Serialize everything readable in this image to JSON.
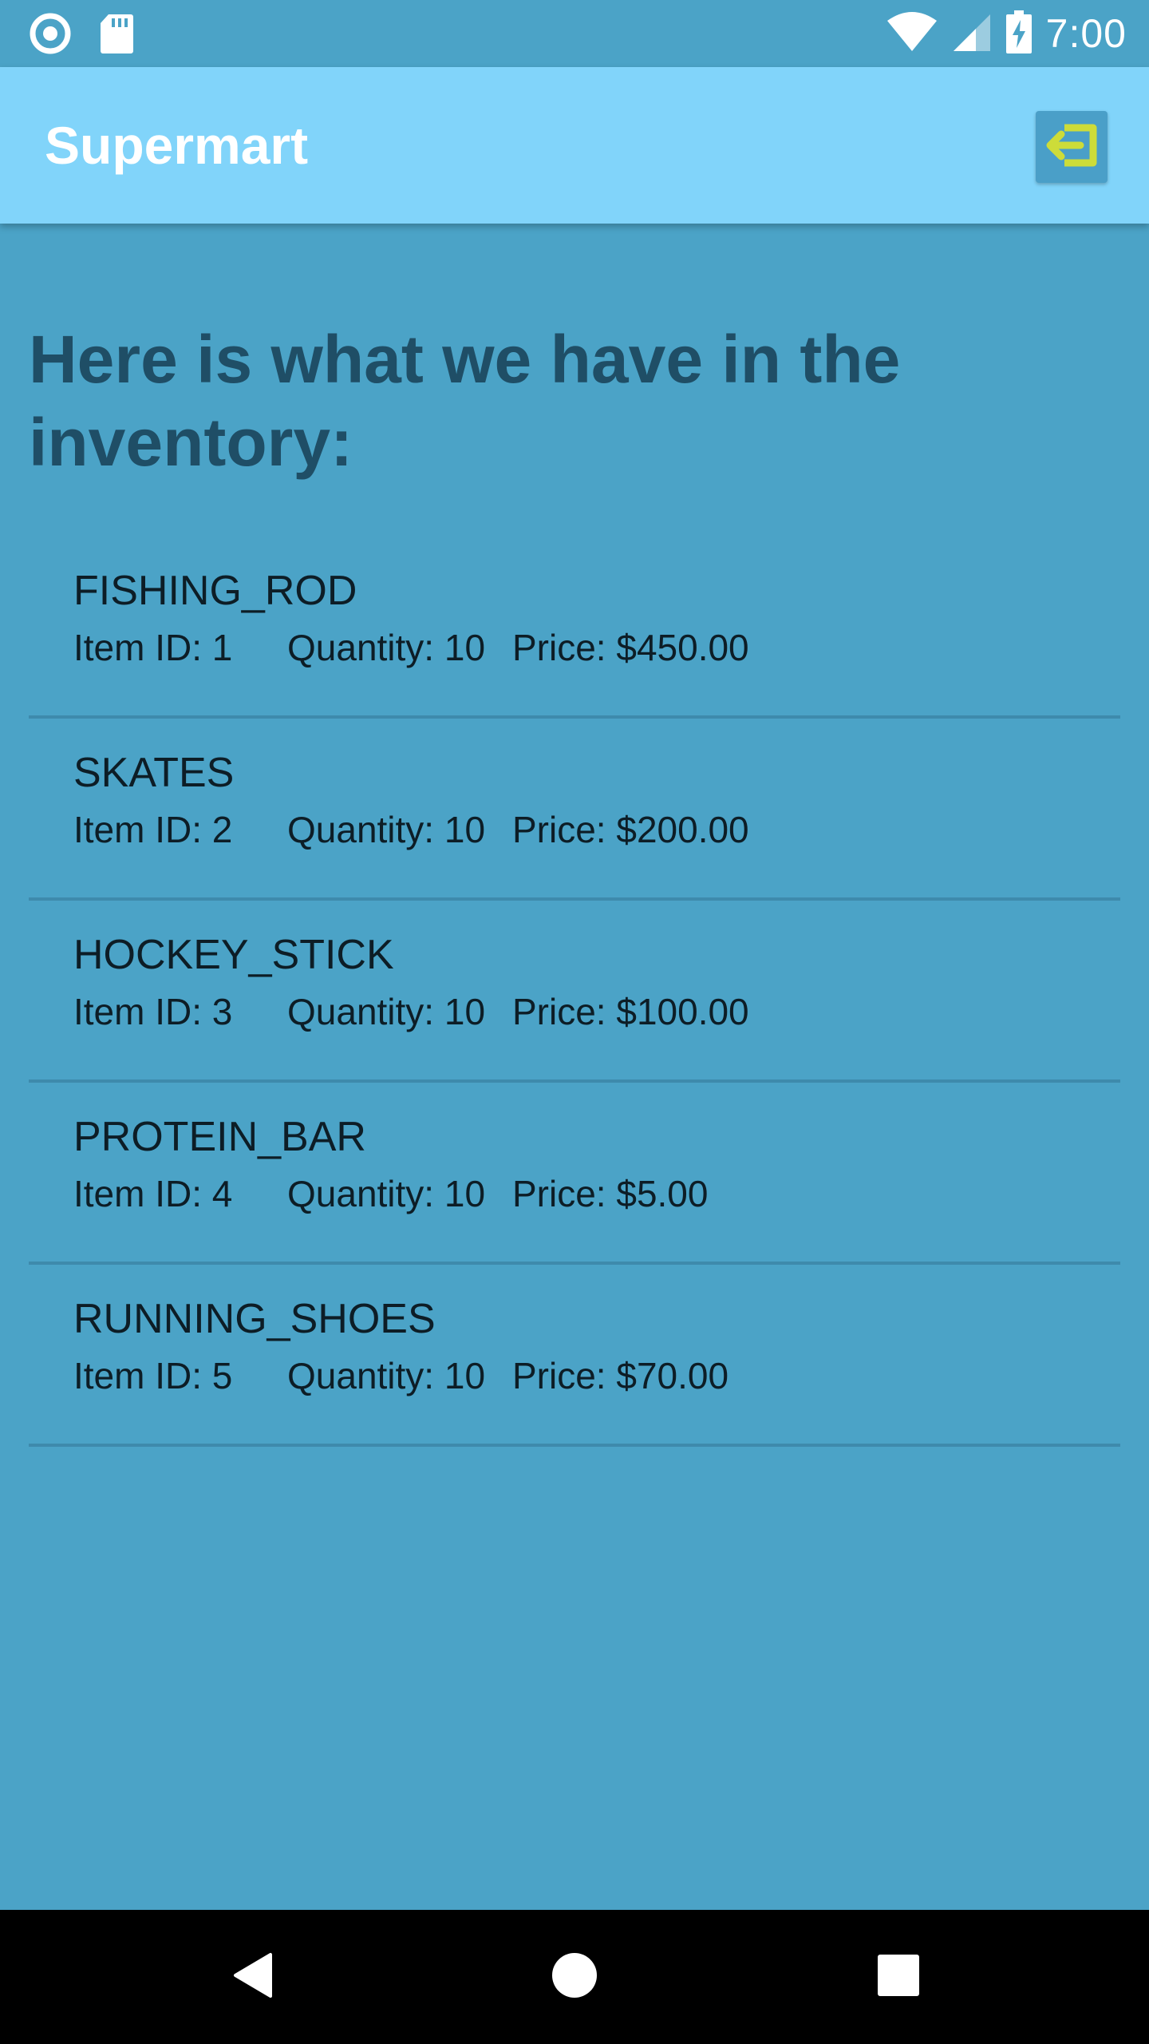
{
  "status_bar": {
    "time": "7:00",
    "icons": [
      "record-icon",
      "sd-card-icon",
      "wifi-icon",
      "signal-icon",
      "battery-charging-icon"
    ]
  },
  "app_bar": {
    "title": "Supermart",
    "logout_icon": "logout-icon"
  },
  "main": {
    "heading": "Here is what we have in the inventory:",
    "items": [
      {
        "name": "FISHING_ROD",
        "id": "Item ID: 1",
        "quantity": "Quantity: 10",
        "price": "Price: $450.00"
      },
      {
        "name": "SKATES",
        "id": "Item ID: 2",
        "quantity": "Quantity: 10",
        "price": "Price: $200.00"
      },
      {
        "name": "HOCKEY_STICK",
        "id": "Item ID: 3",
        "quantity": "Quantity: 10",
        "price": "Price: $100.00"
      },
      {
        "name": "PROTEIN_BAR",
        "id": "Item ID: 4",
        "quantity": "Quantity: 10",
        "price": "Price: $5.00"
      },
      {
        "name": "RUNNING_SHOES",
        "id": "Item ID: 5",
        "quantity": "Quantity: 10",
        "price": "Price: $70.00"
      }
    ]
  },
  "nav_bar": {
    "buttons": [
      "back-icon",
      "home-icon",
      "recents-icon"
    ]
  },
  "colors": {
    "background": "#4ba3c7",
    "app_bar": "#81d4fa",
    "heading": "#1f4e66",
    "logout_accent": "#cddc39",
    "divider": "#3e8aac"
  }
}
